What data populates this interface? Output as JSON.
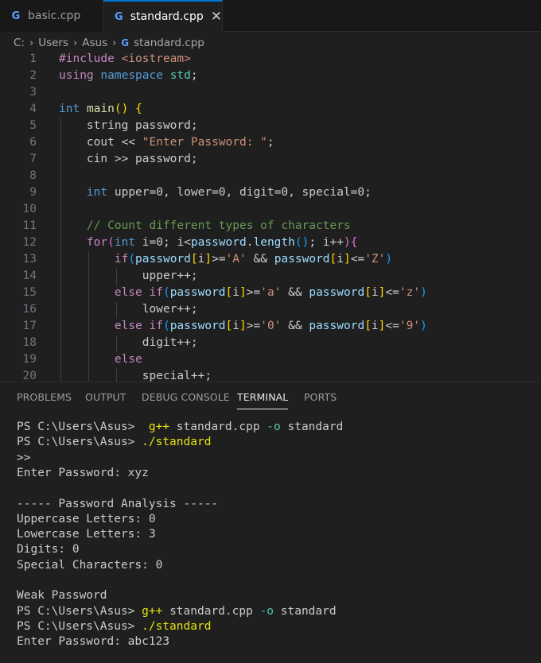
{
  "tabs": [
    {
      "label": "basic.cpp",
      "icon": "cpp-file-icon",
      "active": false
    },
    {
      "label": "standard.cpp",
      "icon": "cpp-file-icon",
      "active": true
    }
  ],
  "breadcrumb": [
    "C:",
    "Users",
    "Asus",
    "standard.cpp"
  ],
  "editor": {
    "lines": [
      {
        "n": "1",
        "tokens": [
          {
            "t": "#include ",
            "c": "k-purple"
          },
          {
            "t": "<iostream>",
            "c": "k-str"
          }
        ]
      },
      {
        "n": "2",
        "tokens": [
          {
            "t": "using",
            "c": "k-purple"
          },
          {
            "t": " "
          },
          {
            "t": "namespace",
            "c": "k-blue"
          },
          {
            "t": " "
          },
          {
            "t": "std",
            "c": "k-teal"
          },
          {
            "t": ";"
          }
        ]
      },
      {
        "n": "3",
        "tokens": []
      },
      {
        "n": "4",
        "tokens": [
          {
            "t": "int",
            "c": "k-blue"
          },
          {
            "t": " "
          },
          {
            "t": "main",
            "c": "k-yel"
          },
          {
            "t": "()",
            "c": "k-gold"
          },
          {
            "t": " "
          },
          {
            "t": "{",
            "c": "k-gold"
          }
        ]
      },
      {
        "n": "5",
        "tokens": [
          {
            "t": "    string password;"
          }
        ]
      },
      {
        "n": "6",
        "tokens": [
          {
            "t": "    cout << "
          },
          {
            "t": "\"Enter Password: \"",
            "c": "k-str"
          },
          {
            "t": ";"
          }
        ]
      },
      {
        "n": "7",
        "tokens": [
          {
            "t": "    cin >> password;"
          }
        ]
      },
      {
        "n": "8",
        "tokens": []
      },
      {
        "n": "9",
        "tokens": [
          {
            "t": "    "
          },
          {
            "t": "int",
            "c": "k-blue"
          },
          {
            "t": " upper=0, lower=0, digit=0, special=0;"
          }
        ]
      },
      {
        "n": "10",
        "tokens": []
      },
      {
        "n": "11",
        "tokens": [
          {
            "t": "    "
          },
          {
            "t": "// Count different types of characters",
            "c": "k-com"
          }
        ]
      },
      {
        "n": "12",
        "tokens": [
          {
            "t": "    "
          },
          {
            "t": "for",
            "c": "k-purple"
          },
          {
            "t": "(",
            "c": "k-pink"
          },
          {
            "t": "int",
            "c": "k-blue"
          },
          {
            "t": " i=0; i<"
          },
          {
            "t": "password",
            "c": "k-var"
          },
          {
            "t": "."
          },
          {
            "t": "length",
            "c": "k-var"
          },
          {
            "t": "()",
            "c": "k-sky"
          },
          {
            "t": "; i++"
          },
          {
            "t": ")",
            "c": "k-pink"
          },
          {
            "t": "{",
            "c": "k-pink"
          }
        ]
      },
      {
        "n": "13",
        "tokens": [
          {
            "t": "        "
          },
          {
            "t": "if",
            "c": "k-purple"
          },
          {
            "t": "(",
            "c": "k-sky"
          },
          {
            "t": "password",
            "c": "k-var"
          },
          {
            "t": "[",
            "c": "k-gold"
          },
          {
            "t": "i"
          },
          {
            "t": "]",
            "c": "k-gold"
          },
          {
            "t": ">="
          },
          {
            "t": "'A'",
            "c": "k-str"
          },
          {
            "t": " && "
          },
          {
            "t": "password",
            "c": "k-var"
          },
          {
            "t": "[",
            "c": "k-gold"
          },
          {
            "t": "i"
          },
          {
            "t": "]",
            "c": "k-gold"
          },
          {
            "t": "<="
          },
          {
            "t": "'Z'",
            "c": "k-str"
          },
          {
            "t": ")",
            "c": "k-sky"
          }
        ]
      },
      {
        "n": "14",
        "tokens": [
          {
            "t": "            upper++;"
          }
        ]
      },
      {
        "n": "15",
        "tokens": [
          {
            "t": "        "
          },
          {
            "t": "else",
            "c": "k-purple"
          },
          {
            "t": " "
          },
          {
            "t": "if",
            "c": "k-purple"
          },
          {
            "t": "(",
            "c": "k-sky"
          },
          {
            "t": "password",
            "c": "k-var"
          },
          {
            "t": "[",
            "c": "k-gold"
          },
          {
            "t": "i"
          },
          {
            "t": "]",
            "c": "k-gold"
          },
          {
            "t": ">="
          },
          {
            "t": "'a'",
            "c": "k-str"
          },
          {
            "t": " && "
          },
          {
            "t": "password",
            "c": "k-var"
          },
          {
            "t": "[",
            "c": "k-gold"
          },
          {
            "t": "i"
          },
          {
            "t": "]",
            "c": "k-gold"
          },
          {
            "t": "<="
          },
          {
            "t": "'z'",
            "c": "k-str"
          },
          {
            "t": ")",
            "c": "k-sky"
          }
        ]
      },
      {
        "n": "16",
        "tokens": [
          {
            "t": "            lower++;"
          }
        ]
      },
      {
        "n": "17",
        "tokens": [
          {
            "t": "        "
          },
          {
            "t": "else",
            "c": "k-purple"
          },
          {
            "t": " "
          },
          {
            "t": "if",
            "c": "k-purple"
          },
          {
            "t": "(",
            "c": "k-sky"
          },
          {
            "t": "password",
            "c": "k-var"
          },
          {
            "t": "[",
            "c": "k-gold"
          },
          {
            "t": "i"
          },
          {
            "t": "]",
            "c": "k-gold"
          },
          {
            "t": ">="
          },
          {
            "t": "'0'",
            "c": "k-str"
          },
          {
            "t": " && "
          },
          {
            "t": "password",
            "c": "k-var"
          },
          {
            "t": "[",
            "c": "k-gold"
          },
          {
            "t": "i"
          },
          {
            "t": "]",
            "c": "k-gold"
          },
          {
            "t": "<="
          },
          {
            "t": "'9'",
            "c": "k-str"
          },
          {
            "t": ")",
            "c": "k-sky"
          }
        ]
      },
      {
        "n": "18",
        "tokens": [
          {
            "t": "            digit++;"
          }
        ]
      },
      {
        "n": "19",
        "tokens": [
          {
            "t": "        "
          },
          {
            "t": "else",
            "c": "k-purple"
          }
        ]
      },
      {
        "n": "20",
        "tokens": [
          {
            "t": "            special++;"
          }
        ]
      }
    ]
  },
  "panel": {
    "tabs": [
      {
        "label": "PROBLEMS",
        "active": false
      },
      {
        "label": "OUTPUT",
        "active": false
      },
      {
        "label": "DEBUG CONSOLE",
        "active": false
      },
      {
        "label": "TERMINAL",
        "active": true
      },
      {
        "label": "PORTS",
        "active": false
      }
    ]
  },
  "terminal": {
    "lines": [
      [
        {
          "t": "PS C:\\Users\\Asus>  "
        },
        {
          "t": "g++",
          "c": "t-yel"
        },
        {
          "t": " standard.cpp "
        },
        {
          "t": "-o",
          "c": "k-teal"
        },
        {
          "t": " standard"
        }
      ],
      [
        {
          "t": "PS C:\\Users\\Asus> "
        },
        {
          "t": "./standard",
          "c": "t-yel"
        }
      ],
      [
        {
          "t": ">>"
        }
      ],
      [
        {
          "t": "Enter Password: xyz"
        }
      ],
      [],
      [
        {
          "t": "----- Password Analysis -----"
        }
      ],
      [
        {
          "t": "Uppercase Letters: 0"
        }
      ],
      [
        {
          "t": "Lowercase Letters: 3"
        }
      ],
      [
        {
          "t": "Digits: 0"
        }
      ],
      [
        {
          "t": "Special Characters: 0"
        }
      ],
      [],
      [
        {
          "t": "Weak Password"
        }
      ],
      [
        {
          "t": "PS C:\\Users\\Asus> "
        },
        {
          "t": "g++",
          "c": "t-yel"
        },
        {
          "t": " standard.cpp "
        },
        {
          "t": "-o",
          "c": "k-teal"
        },
        {
          "t": " standard"
        }
      ],
      [
        {
          "t": "PS C:\\Users\\Asus> "
        },
        {
          "t": "./standard",
          "c": "t-yel"
        }
      ],
      [
        {
          "t": "Enter Password: abc123"
        }
      ]
    ]
  },
  "colors": {
    "accent": "#0078d4",
    "editor_bg": "#1f1f1f",
    "tab_bg": "#181818"
  }
}
